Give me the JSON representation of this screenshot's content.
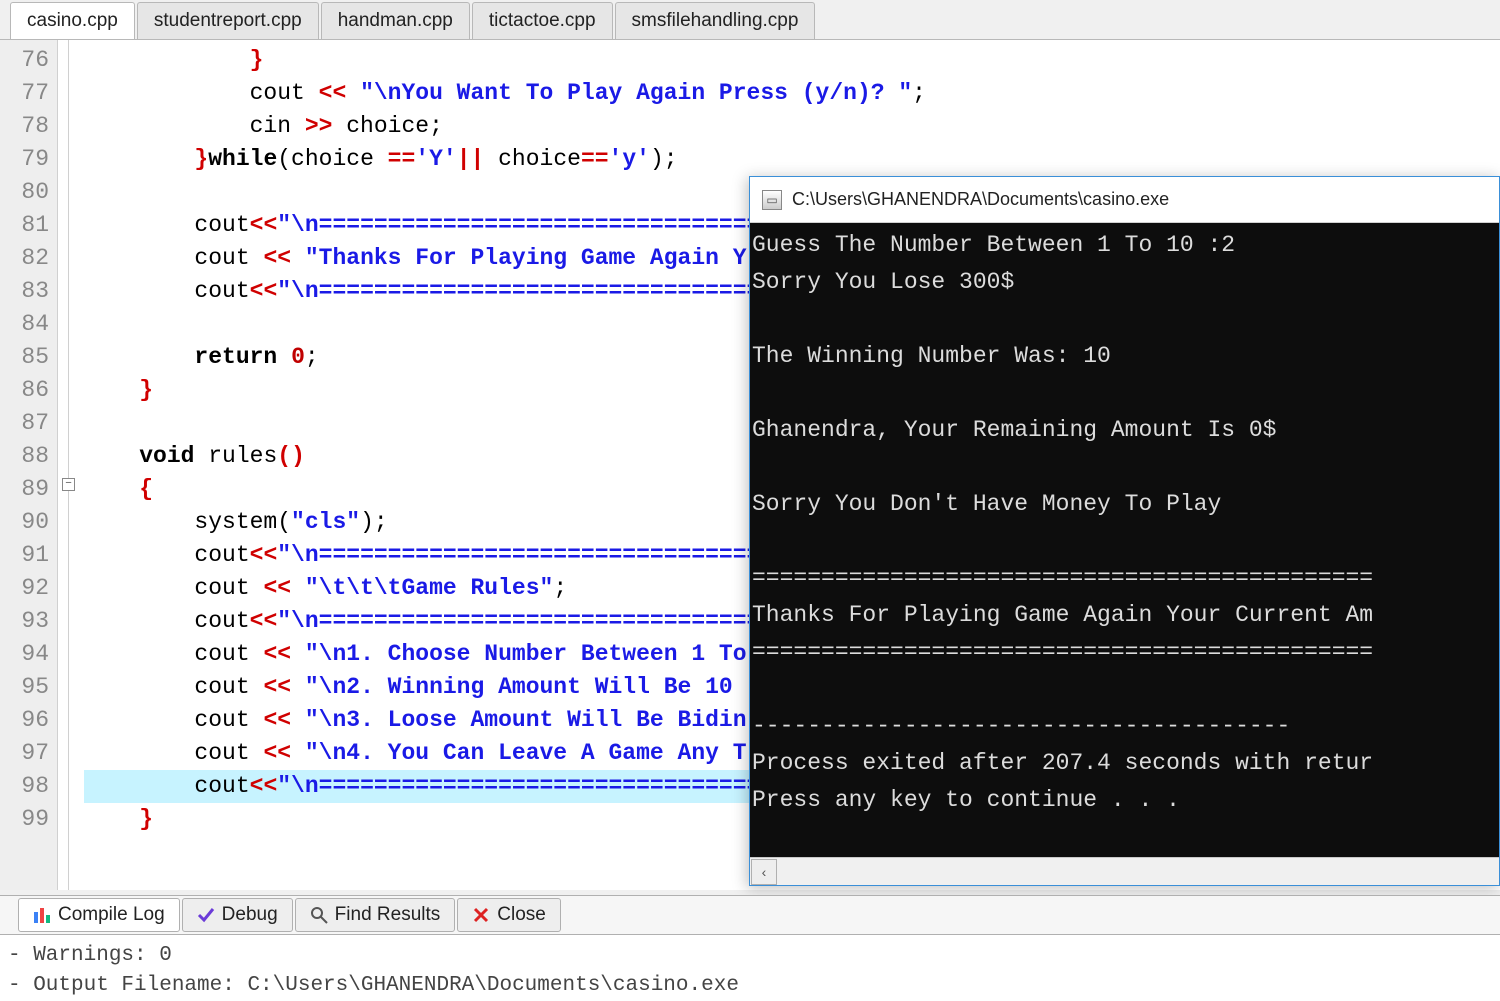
{
  "tabs": [
    {
      "label": "casino.cpp",
      "active": true
    },
    {
      "label": "studentreport.cpp",
      "active": false
    },
    {
      "label": "handman.cpp",
      "active": false
    },
    {
      "label": "tictactoe.cpp",
      "active": false
    },
    {
      "label": "smsfilehandling.cpp",
      "active": false
    }
  ],
  "line_start": 76,
  "line_end": 99,
  "code_lines": [
    {
      "n": 76,
      "seg": [
        {
          "t": "            ",
          "c": ""
        },
        {
          "t": "}",
          "c": "br"
        }
      ]
    },
    {
      "n": 77,
      "seg": [
        {
          "t": "            cout ",
          "c": ""
        },
        {
          "t": "<<",
          "c": "op"
        },
        {
          "t": " ",
          "c": ""
        },
        {
          "t": "\"\\nYou Want To Play Again Press (y/n)? \"",
          "c": "str"
        },
        {
          "t": ";",
          "c": ""
        }
      ]
    },
    {
      "n": 78,
      "seg": [
        {
          "t": "            cin ",
          "c": ""
        },
        {
          "t": ">>",
          "c": "op"
        },
        {
          "t": " choice;",
          "c": ""
        }
      ]
    },
    {
      "n": 79,
      "seg": [
        {
          "t": "        ",
          "c": ""
        },
        {
          "t": "}",
          "c": "br"
        },
        {
          "t": "while",
          "c": "kw"
        },
        {
          "t": "(choice ",
          "c": ""
        },
        {
          "t": "==",
          "c": "op"
        },
        {
          "t": "'Y'",
          "c": "chlit"
        },
        {
          "t": "||",
          "c": "op"
        },
        {
          "t": " choice",
          "c": ""
        },
        {
          "t": "==",
          "c": "op"
        },
        {
          "t": "'y'",
          "c": "chlit"
        },
        {
          "t": ");",
          "c": ""
        }
      ]
    },
    {
      "n": 80,
      "seg": [
        {
          "t": " ",
          "c": ""
        }
      ]
    },
    {
      "n": 81,
      "seg": [
        {
          "t": "        cout",
          "c": ""
        },
        {
          "t": "<<",
          "c": "op"
        },
        {
          "t": "\"\\n=========================================",
          "c": "str"
        }
      ]
    },
    {
      "n": 82,
      "seg": [
        {
          "t": "        cout ",
          "c": ""
        },
        {
          "t": "<<",
          "c": "op"
        },
        {
          "t": " ",
          "c": ""
        },
        {
          "t": "\"Thanks For Playing Game Again Y",
          "c": "str"
        }
      ]
    },
    {
      "n": 83,
      "seg": [
        {
          "t": "        cout",
          "c": ""
        },
        {
          "t": "<<",
          "c": "op"
        },
        {
          "t": "\"\\n=========================================",
          "c": "str"
        }
      ]
    },
    {
      "n": 84,
      "seg": [
        {
          "t": " ",
          "c": ""
        }
      ]
    },
    {
      "n": 85,
      "seg": [
        {
          "t": "        ",
          "c": ""
        },
        {
          "t": "return",
          "c": "kw"
        },
        {
          "t": " ",
          "c": ""
        },
        {
          "t": "0",
          "c": "num"
        },
        {
          "t": ";",
          "c": ""
        }
      ]
    },
    {
      "n": 86,
      "seg": [
        {
          "t": "    ",
          "c": ""
        },
        {
          "t": "}",
          "c": "br"
        }
      ]
    },
    {
      "n": 87,
      "seg": [
        {
          "t": " ",
          "c": ""
        }
      ]
    },
    {
      "n": 88,
      "seg": [
        {
          "t": "    ",
          "c": ""
        },
        {
          "t": "void",
          "c": "kw"
        },
        {
          "t": " rules",
          "c": ""
        },
        {
          "t": "()",
          "c": "br"
        }
      ]
    },
    {
      "n": 89,
      "seg": [
        {
          "t": "    ",
          "c": ""
        },
        {
          "t": "{",
          "c": "br"
        }
      ]
    },
    {
      "n": 90,
      "seg": [
        {
          "t": "        system(",
          "c": ""
        },
        {
          "t": "\"cls\"",
          "c": "str"
        },
        {
          "t": ");",
          "c": ""
        }
      ]
    },
    {
      "n": 91,
      "seg": [
        {
          "t": "        cout",
          "c": ""
        },
        {
          "t": "<<",
          "c": "op"
        },
        {
          "t": "\"\\n=========================================",
          "c": "str"
        }
      ]
    },
    {
      "n": 92,
      "seg": [
        {
          "t": "        cout ",
          "c": ""
        },
        {
          "t": "<<",
          "c": "op"
        },
        {
          "t": " ",
          "c": ""
        },
        {
          "t": "\"\\t\\t\\tGame Rules\"",
          "c": "str"
        },
        {
          "t": ";",
          "c": ""
        }
      ]
    },
    {
      "n": 93,
      "seg": [
        {
          "t": "        cout",
          "c": ""
        },
        {
          "t": "<<",
          "c": "op"
        },
        {
          "t": "\"\\n=========================================",
          "c": "str"
        }
      ]
    },
    {
      "n": 94,
      "seg": [
        {
          "t": "        cout ",
          "c": ""
        },
        {
          "t": "<<",
          "c": "op"
        },
        {
          "t": " ",
          "c": ""
        },
        {
          "t": "\"\\n1. Choose Number Between 1 To ",
          "c": "str"
        }
      ]
    },
    {
      "n": 95,
      "seg": [
        {
          "t": "        cout ",
          "c": ""
        },
        {
          "t": "<<",
          "c": "op"
        },
        {
          "t": " ",
          "c": ""
        },
        {
          "t": "\"\\n2. Winning Amount Will Be 10 ",
          "c": "str"
        }
      ]
    },
    {
      "n": 96,
      "seg": [
        {
          "t": "        cout ",
          "c": ""
        },
        {
          "t": "<<",
          "c": "op"
        },
        {
          "t": " ",
          "c": ""
        },
        {
          "t": "\"\\n3. Loose Amount Will Be Bidin",
          "c": "str"
        }
      ]
    },
    {
      "n": 97,
      "seg": [
        {
          "t": "        cout ",
          "c": ""
        },
        {
          "t": "<<",
          "c": "op"
        },
        {
          "t": " ",
          "c": ""
        },
        {
          "t": "\"\\n4. You Can Leave A Game Any T",
          "c": "str"
        }
      ]
    },
    {
      "n": 98,
      "hl": true,
      "seg": [
        {
          "t": "        cout",
          "c": ""
        },
        {
          "t": "<<",
          "c": "op"
        },
        {
          "t": "\"\\n=========================================",
          "c": "str"
        }
      ]
    },
    {
      "n": 99,
      "seg": [
        {
          "t": "    ",
          "c": ""
        },
        {
          "t": "}",
          "c": "br"
        }
      ]
    }
  ],
  "console": {
    "title": "C:\\Users\\GHANENDRA\\Documents\\casino.exe",
    "lines": [
      "Guess The Number Between 1 To 10 :2",
      "Sorry You Lose 300$",
      "",
      "The Winning Number Was: 10",
      "",
      "Ghanendra, Your Remaining Amount Is 0$",
      "",
      "Sorry You Don't Have Money To Play",
      "",
      "=============================================",
      "Thanks For Playing Game Again Your Current Am",
      "=============================================",
      "",
      "---------------------------------------",
      "Process exited after 207.4 seconds with retur",
      "Press any key to continue . . ."
    ]
  },
  "bottom_tabs": {
    "compile_log": "Compile Log",
    "debug": "Debug",
    "find": "Find Results",
    "close": "Close"
  },
  "output": {
    "l1": "- Warnings: 0",
    "l2": "- Output Filename: C:\\Users\\GHANENDRA\\Documents\\casino.exe"
  }
}
